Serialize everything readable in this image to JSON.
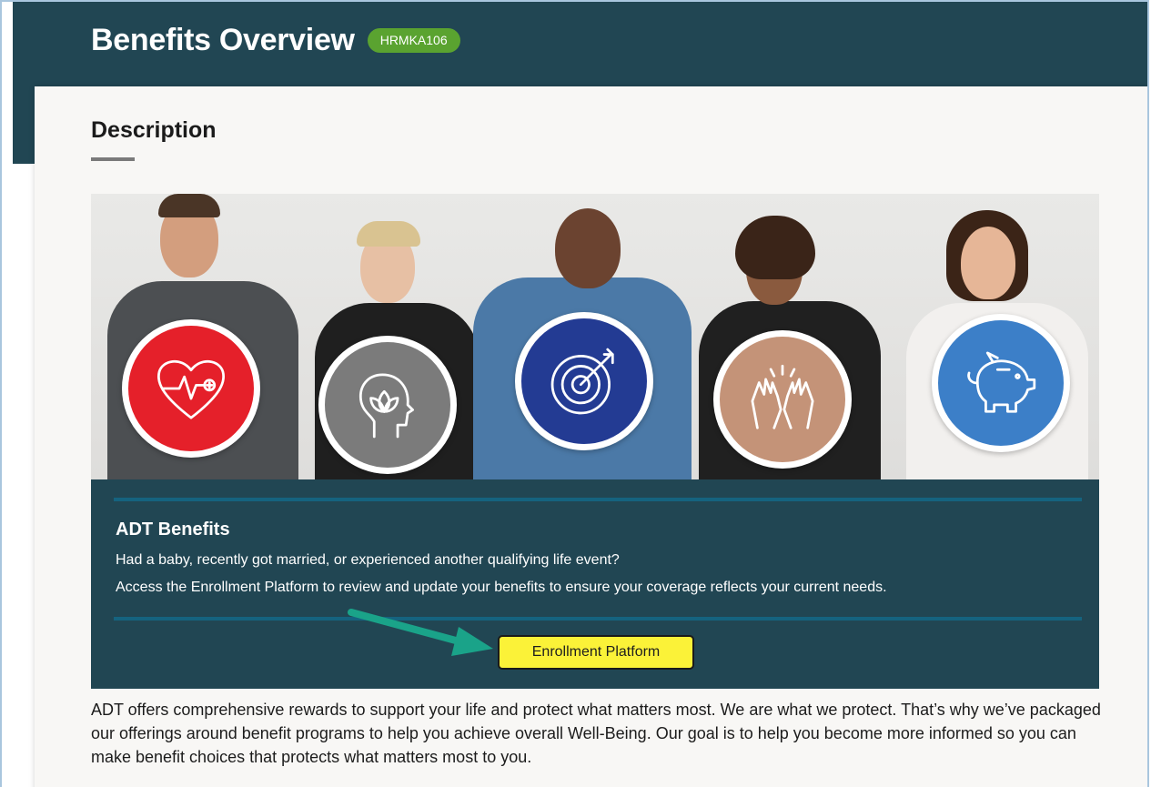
{
  "header": {
    "title": "Benefits Overview",
    "badge": "HRMKA106"
  },
  "description": {
    "title": "Description"
  },
  "hero": {
    "icons": [
      "heart-pulse-icon",
      "mind-lotus-icon",
      "target-arrow-icon",
      "high-five-icon",
      "piggy-bank-icon"
    ],
    "circle_colors": [
      "#e5202a",
      "#7b7b7b",
      "#233b93",
      "#c49378",
      "#3c7fc8"
    ]
  },
  "banner": {
    "title": "ADT Benefits",
    "line1": "Had a baby, recently got married, or experienced another qualifying life event?",
    "line2": "Access the Enrollment Platform to review and update your benefits to ensure your coverage reflects your current needs.",
    "button_label": "Enrollment Platform"
  },
  "body": {
    "paragraph": "ADT offers comprehensive rewards to support your life and protect what matters most. We are what we protect. That’s why we’ve packaged our offerings around benefit programs to help you achieve overall Well-Being. Our goal is to help you become more informed so you can make benefit choices that protects what matters most to you."
  },
  "colors": {
    "header_bg": "#214653",
    "badge_bg": "#5aa330",
    "button_bg": "#fbf238",
    "arrow": "#1aa389"
  }
}
